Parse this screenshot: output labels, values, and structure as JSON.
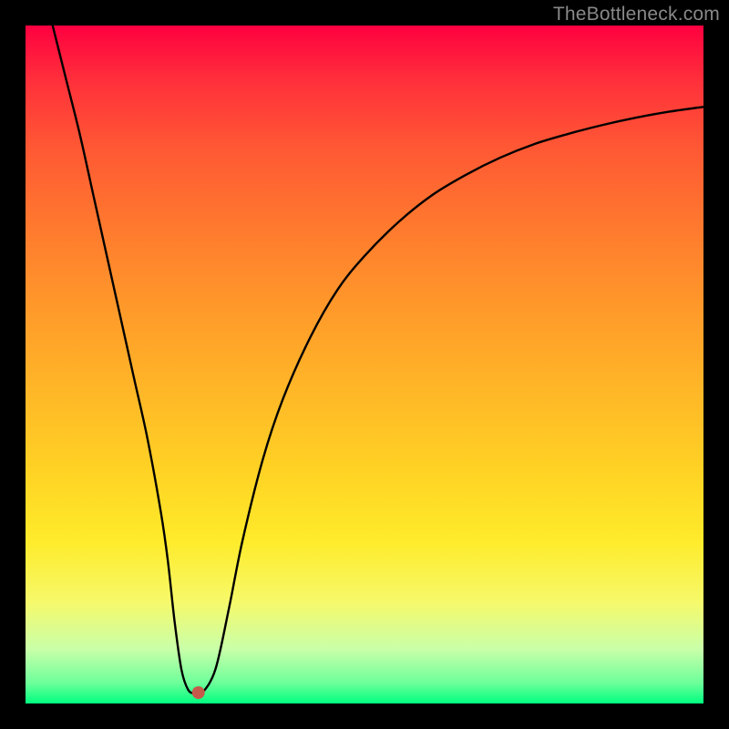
{
  "watermark": "TheBottleneck.com",
  "chart_data": {
    "type": "line",
    "title": "",
    "xlabel": "",
    "ylabel": "",
    "xlim": [
      0,
      100
    ],
    "ylim": [
      0,
      100
    ],
    "x": [
      4,
      6,
      8,
      10,
      12,
      14,
      16,
      18,
      20,
      21,
      22,
      23,
      24,
      25,
      26,
      28,
      30,
      32,
      35,
      38,
      42,
      46,
      50,
      55,
      60,
      65,
      70,
      75,
      80,
      85,
      90,
      95,
      100
    ],
    "y": [
      100,
      92,
      84,
      75,
      66,
      57,
      48,
      39,
      28,
      21,
      12,
      5,
      2,
      1.5,
      1.5,
      5,
      14,
      24,
      36,
      45,
      54,
      61,
      66,
      71,
      75,
      78,
      80.5,
      82.5,
      84,
      85.3,
      86.4,
      87.3,
      88
    ],
    "marker": {
      "x": 25.5,
      "y": 1.6,
      "color": "#c65a4a",
      "radius_px": 7
    },
    "background": "vertical-gradient red→orange→yellow→green",
    "grid": false
  }
}
